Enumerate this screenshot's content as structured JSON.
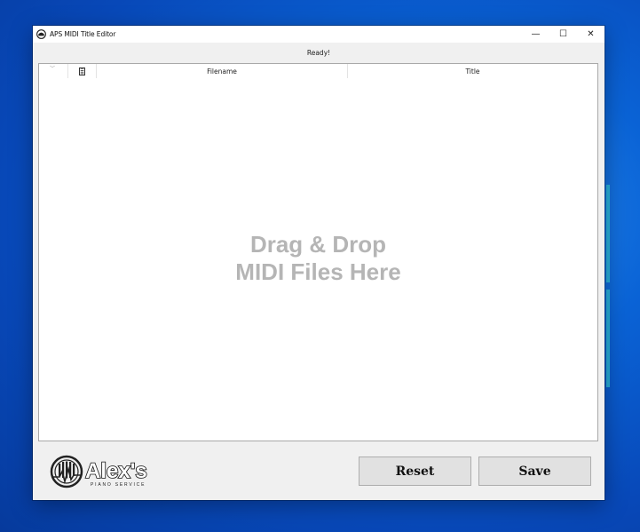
{
  "window": {
    "title": "APS MIDI Title Editor",
    "controls": {
      "minimize": "—",
      "maximize": "☐",
      "close": "✕"
    }
  },
  "status": {
    "text": "Ready!"
  },
  "list": {
    "columns": [
      "Filename",
      "Title"
    ],
    "empty_hint_line1": "Drag & Drop",
    "empty_hint_line2": "MIDI Files Here"
  },
  "logo": {
    "main_text": "Alex's",
    "sub_text": "PIANO SERVICE"
  },
  "buttons": {
    "reset": "Reset",
    "save": "Save"
  },
  "colors": {
    "hint_text": "#b5b5b5",
    "button_bg": "#e1e1e1",
    "desktop_blue": "#0a63d6"
  }
}
